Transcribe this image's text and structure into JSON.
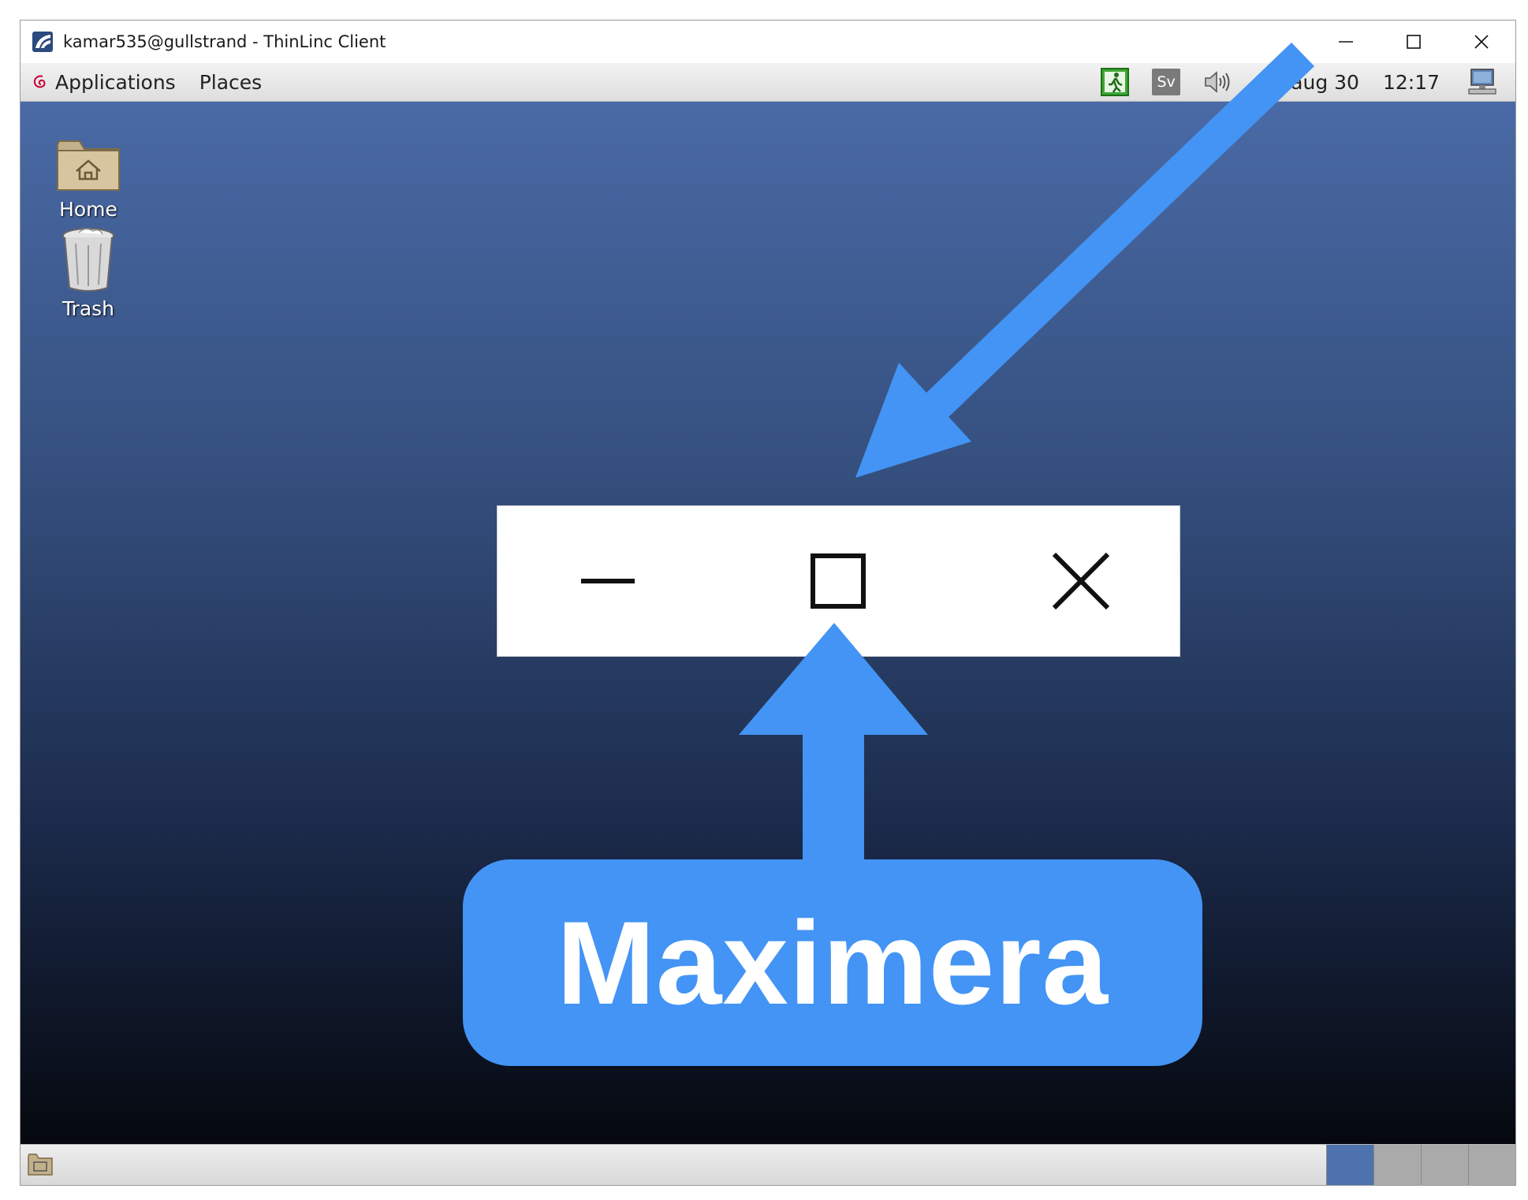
{
  "window": {
    "title": "kamar535@gullstrand - ThinLinc Client",
    "icon": "thinlinc-icon",
    "controls": [
      "minimize-icon",
      "maximize-icon",
      "close-icon"
    ]
  },
  "top_panel": {
    "menu_applications": "Applications",
    "menu_places": "Places",
    "keyboard_layout": "Sv",
    "date": "aug 30",
    "time": "12:17"
  },
  "desktop": {
    "icons": [
      {
        "label": "Home",
        "icon": "home-folder-icon"
      },
      {
        "label": "Trash",
        "icon": "trash-icon"
      }
    ]
  },
  "annotation": {
    "callout_text": "Maximera",
    "accent": "#4394f4"
  }
}
